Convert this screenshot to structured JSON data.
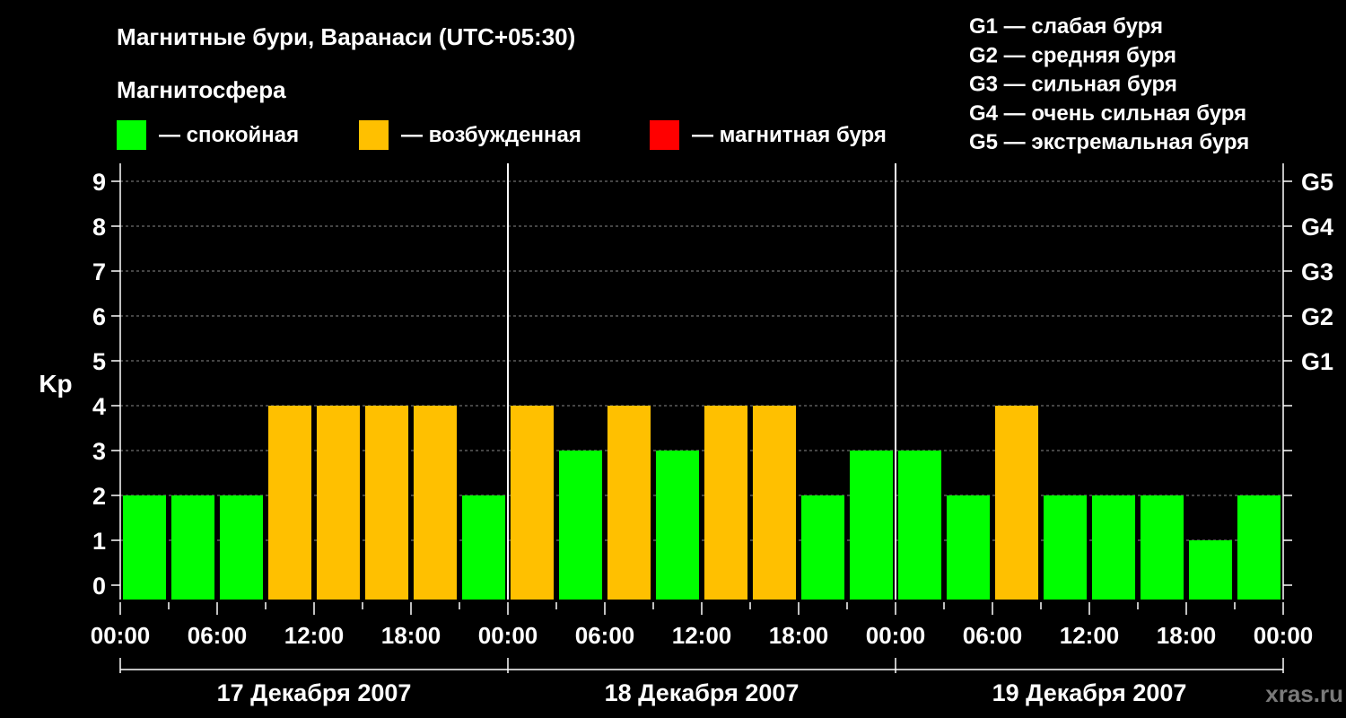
{
  "chart_data": {
    "type": "bar",
    "title": "Магнитные бури, Варанаси (UTC+05:30)",
    "subtitle": "Магнитосфера",
    "ylabel": "Kp",
    "ylim": [
      0,
      9
    ],
    "yticks": [
      "0",
      "1",
      "2",
      "3",
      "4",
      "5",
      "6",
      "7",
      "8",
      "9"
    ],
    "right_ticks": [
      {
        "kp": 5,
        "label": "G1"
      },
      {
        "kp": 6,
        "label": "G2"
      },
      {
        "kp": 7,
        "label": "G3"
      },
      {
        "kp": 8,
        "label": "G4"
      },
      {
        "kp": 9,
        "label": "G5"
      }
    ],
    "xticks": [
      "00:00",
      "06:00",
      "12:00",
      "18:00",
      "00:00",
      "06:00",
      "12:00",
      "18:00",
      "00:00",
      "06:00",
      "12:00",
      "18:00",
      "00:00"
    ],
    "days": [
      "17 Декабря 2007",
      "18 Декабря 2007",
      "19 Декабря 2007"
    ],
    "hours_per_bar": 3,
    "bar_offset_hours": 1.5,
    "values": [
      2,
      2,
      2,
      4,
      4,
      4,
      4,
      2,
      4,
      3,
      4,
      3,
      4,
      4,
      2,
      3,
      3,
      2,
      4,
      2,
      2,
      2,
      1,
      2
    ],
    "categories": [
      "quiet",
      "quiet",
      "quiet",
      "excited",
      "excited",
      "excited",
      "excited",
      "quiet",
      "excited",
      "quiet",
      "excited",
      "quiet",
      "excited",
      "excited",
      "quiet",
      "quiet",
      "quiet",
      "quiet",
      "excited",
      "quiet",
      "quiet",
      "quiet",
      "quiet",
      "quiet"
    ],
    "legend": [
      {
        "key": "quiet",
        "label": "— спокойная",
        "color": "#00ff00"
      },
      {
        "key": "excited",
        "label": "— возбужденная",
        "color": "#ffc000"
      },
      {
        "key": "storm",
        "label": "— магнитная буря",
        "color": "#ff0000"
      }
    ],
    "storm_scale": [
      "G1 — слабая буря",
      "G2 — средняя буря",
      "G3 — сильная буря",
      "G4 — очень сильная буря",
      "G5 — экстремальная буря"
    ],
    "grid": true
  },
  "watermark": "xras.ru"
}
